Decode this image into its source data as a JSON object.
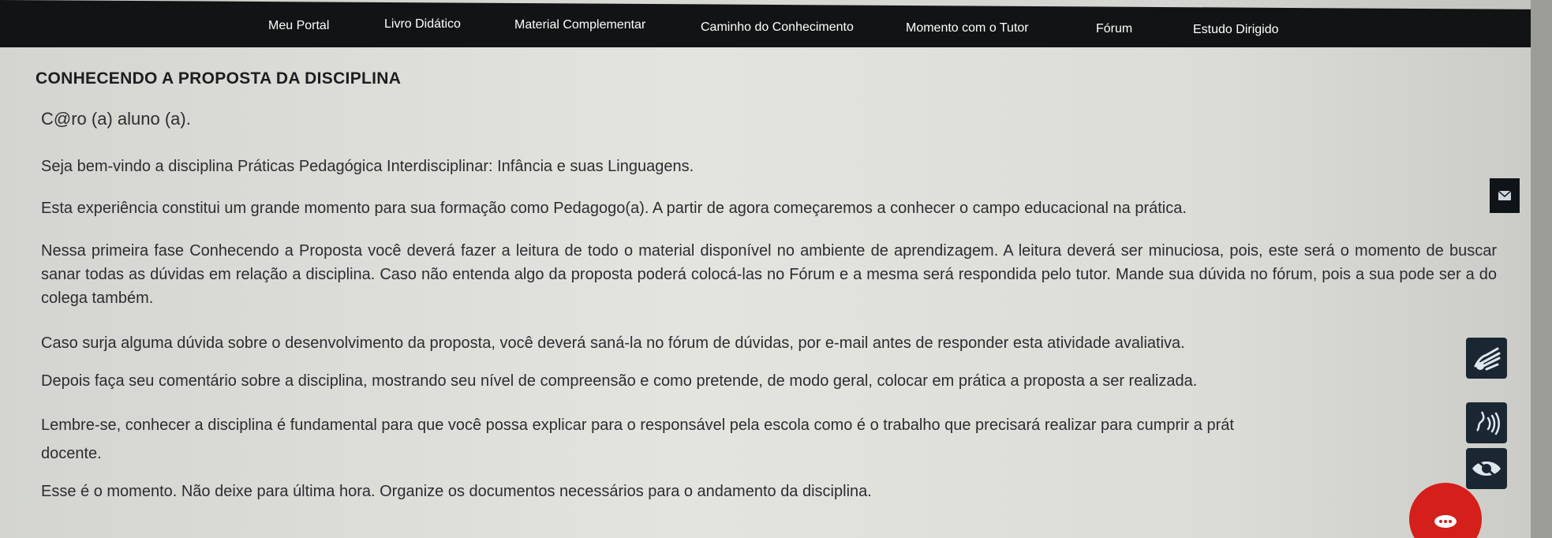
{
  "nav": {
    "items": [
      {
        "label": "Meu Portal"
      },
      {
        "label": "Livro Didático"
      },
      {
        "label": "Material Complementar"
      },
      {
        "label": "Caminho do Conhecimento"
      },
      {
        "label": "Momento com o Tutor"
      },
      {
        "label": "Fórum"
      },
      {
        "label": "Estudo Dirigido"
      }
    ]
  },
  "main": {
    "title": "CONHECENDO A PROPOSTA DA DISCIPLINA",
    "paragraphs": [
      "C@ro (a) aluno (a).",
      "Seja bem-vindo a disciplina Práticas Pedagógica Interdisciplinar: Infância e suas Linguagens.",
      "Esta experiência constitui um grande momento para sua formação como Pedagogo(a). A partir de agora começaremos a conhecer o campo educacional na prática.",
      "Nessa primeira fase Conhecendo a Proposta você deverá fazer a leitura de todo o material disponível no ambiente de aprendizagem. A leitura deverá ser minuciosa, pois, este será o momento de buscar sanar todas as dúvidas em relação a disciplina. Caso não entenda algo da proposta poderá colocá-las no Fórum e a mesma será respondida pelo tutor. Mande sua dúvida no fórum, pois a sua pode ser a do colega também.",
      "Caso surja alguma dúvida sobre o desenvolvimento da proposta, você deverá saná-la no fórum de dúvidas, por e-mail antes de responder esta atividade avaliativa.",
      "Depois faça seu comentário sobre a disciplina, mostrando seu nível de compreensão e como pretende, de modo geral, colocar em prática a proposta a ser realizada.",
      "Lembre-se, conhecer a disciplina é fundamental para que você possa explicar para o responsável pela escola como é o trabalho que precisará realizar para cumprir a prát",
      "docente.",
      "Esse é o momento. Não deixe para última hora. Organize os documentos necessários para o andamento da disciplina."
    ]
  },
  "accessibility": {
    "icons": [
      "mail-icon",
      "sign-language-icon",
      "audio-description-icon",
      "low-vision-icon",
      "chat-icon"
    ]
  },
  "colors": {
    "nav_bg": "#121314",
    "chat_button": "#d41f1b",
    "accessibility_button": "#1a2733"
  }
}
